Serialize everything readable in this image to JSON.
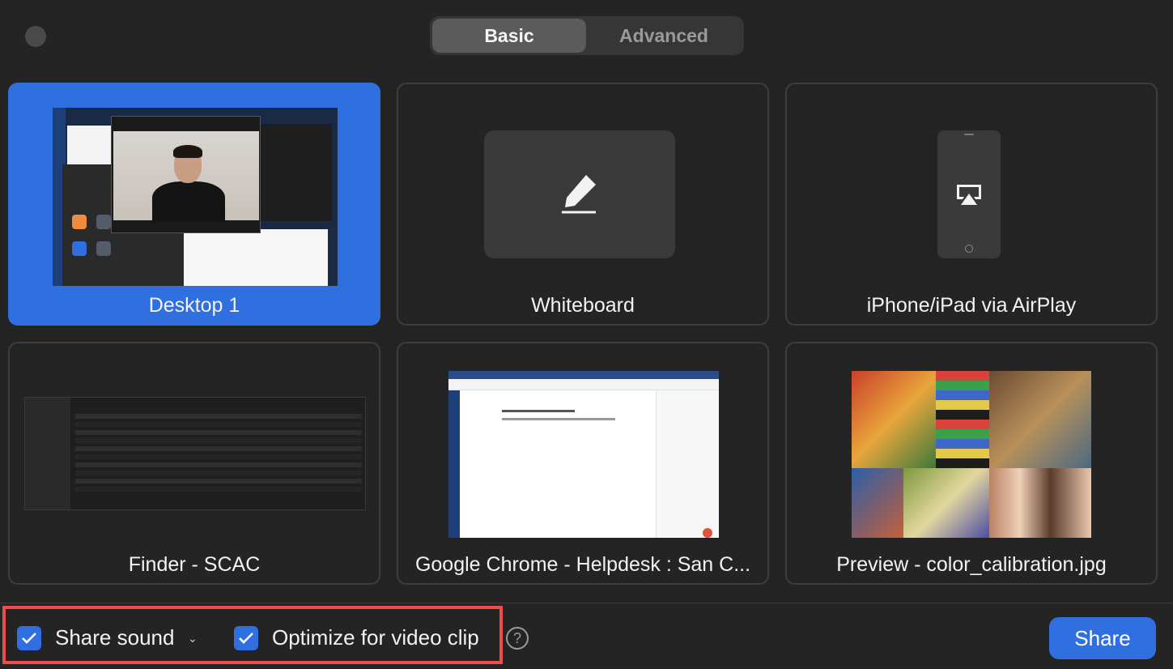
{
  "tabs": {
    "basic": "Basic",
    "advanced": "Advanced"
  },
  "sources": [
    {
      "label": "Desktop 1",
      "selected": true
    },
    {
      "label": "Whiteboard",
      "selected": false
    },
    {
      "label": "iPhone/iPad via AirPlay",
      "selected": false
    },
    {
      "label": "Finder - SCAC",
      "selected": false
    },
    {
      "label": "Google Chrome - Helpdesk : San C...",
      "selected": false
    },
    {
      "label": "Preview - color_calibration.jpg",
      "selected": false
    }
  ],
  "options": {
    "share_sound": {
      "label": "Share sound",
      "checked": true
    },
    "optimize_video": {
      "label": "Optimize for video clip",
      "checked": true
    },
    "help_glyph": "?"
  },
  "actions": {
    "share_label": "Share"
  },
  "colors": {
    "accent": "#2f6fe0",
    "highlight": "#ef4b4b",
    "background": "#242424"
  }
}
